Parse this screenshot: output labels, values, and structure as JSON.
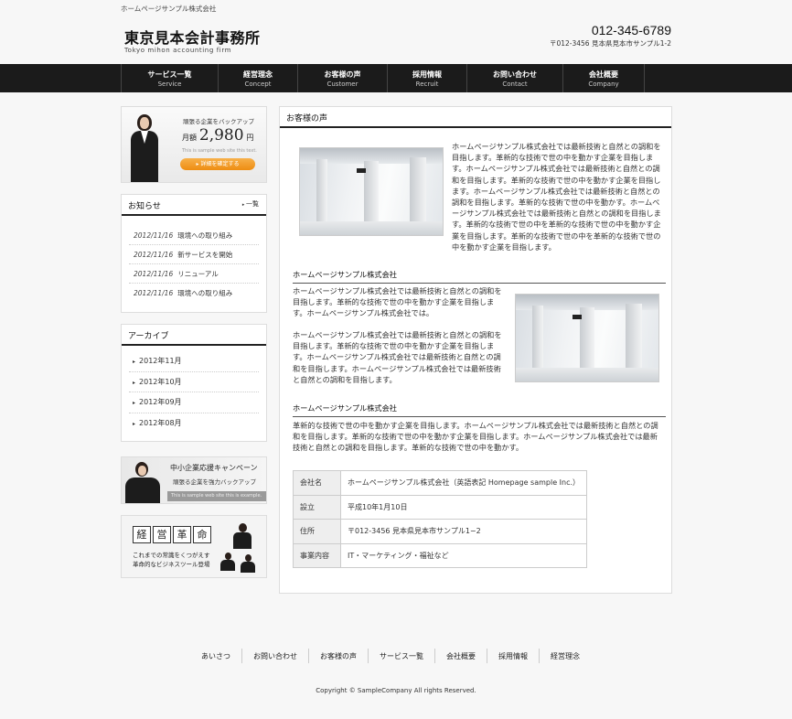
{
  "header": {
    "tagline": "ホームページサンプル株式会社",
    "logo_main": "東京見本会計事務所",
    "logo_sub": "Tokyo mihon accounting firm",
    "phone": "012-345-6789",
    "address": "〒012-3456 見本県見本市サンプル1-2"
  },
  "nav": [
    {
      "jp": "サービス一覧",
      "en": "Service"
    },
    {
      "jp": "経営理念",
      "en": "Concept"
    },
    {
      "jp": "お客様の声",
      "en": "Customer"
    },
    {
      "jp": "採用情報",
      "en": "Recruit"
    },
    {
      "jp": "お問い合わせ",
      "en": "Contact"
    },
    {
      "jp": "会社概要",
      "en": "Company"
    }
  ],
  "banner1": {
    "catch": "頑張る企業をバックアップ",
    "price_prefix": "月額",
    "price": "2,980",
    "price_unit": "円",
    "note": "This is sample web site this text.",
    "button": "詳細を確定する"
  },
  "news": {
    "title": "お知らせ",
    "more": "一覧",
    "items": [
      {
        "date": "2012/11/16",
        "text": "環境への取り組み"
      },
      {
        "date": "2012/11/16",
        "text": "新サービスを開始"
      },
      {
        "date": "2012/11/16",
        "text": "リニューアル"
      },
      {
        "date": "2012/11/16",
        "text": "環境への取り組み"
      }
    ]
  },
  "archive": {
    "title": "アーカイブ",
    "items": [
      "2012年11月",
      "2012年10月",
      "2012年09月",
      "2012年08月"
    ]
  },
  "banner2": {
    "line1": "中小企業応援キャンペーン",
    "line2": "頑張る企業を強力バックアップ",
    "line3": "This is sample web site this is example."
  },
  "banner3": {
    "kanji": [
      "経",
      "営",
      "革",
      "命"
    ],
    "line1": "これまでの常識をくつがえす",
    "line2": "革命的なビジネスツール登場"
  },
  "main": {
    "title": "お客様の声",
    "intro": [
      "ホームページサンプル株式会社では最新技術と自然との調和を",
      "目指します。革新的な技術で世の中を動かす企業を目指しま",
      "す。ホームページサンプル株式会社では最新技術と自然との調",
      "和を目指します。革新的な技術で世の中を動かす企業を目指し",
      "ます。ホームページサンプル株式会社では最新技術と自然との",
      "調和を目指します。革新的な技術で世の中を動かす。ホームペ",
      "ージサンプル株式会社では最新技術と自然との調和を目指しま",
      "す。革新的な技術で世の中を革新的な技術で世の中を動かす企",
      "業を目指します。革新的な技術で世の中を革新的な技術で世の",
      "中を動かす企業を目指します。"
    ],
    "section1_title": "ホームページサンプル株式会社",
    "section1_p1": [
      "ホームページサンプル株式会社では最新技術と自然との調和を",
      "目指します。革新的な技術で世の中を動かす企業を目指しま",
      "す。ホームページサンプル株式会社では。"
    ],
    "section1_p2": [
      "ホームページサンプル株式会社では最新技術と自然との調和を",
      "目指します。革新的な技術で世の中を動かす企業を目指しま",
      "す。ホームページサンプル株式会社では最新技術と自然との調",
      "和を目指します。ホームページサンプル株式会社では最新技術",
      "と自然との調和を目指します。"
    ],
    "section2_title": "ホームページサンプル株式会社",
    "section2_p": [
      "革新的な技術で世の中を動かす企業を目指します。ホームページサンプル株式会社では最新技術と自然との調",
      "和を目指します。革新的な技術で世の中を動かす企業を目指します。ホームページサンプル株式会社では最新",
      "技術と自然との調和を目指します。革新的な技術で世の中を動かす。"
    ],
    "table": [
      {
        "k": "会社名",
        "v": "ホームページサンプル株式会社（英語表記 Homepage sample Inc.）"
      },
      {
        "k": "設立",
        "v": "平成10年1月10日"
      },
      {
        "k": "住所",
        "v": "〒012-3456 見本県見本市サンプル1−2"
      },
      {
        "k": "事業内容",
        "v": "IT・マーケティング・福祉など"
      }
    ]
  },
  "footer": {
    "links": [
      "あいさつ",
      "お問い合わせ",
      "お客様の声",
      "サービス一覧",
      "会社概要",
      "採用情報",
      "経営理念"
    ],
    "copyright": "Copyright © SampleCompany All rights Reserved."
  }
}
